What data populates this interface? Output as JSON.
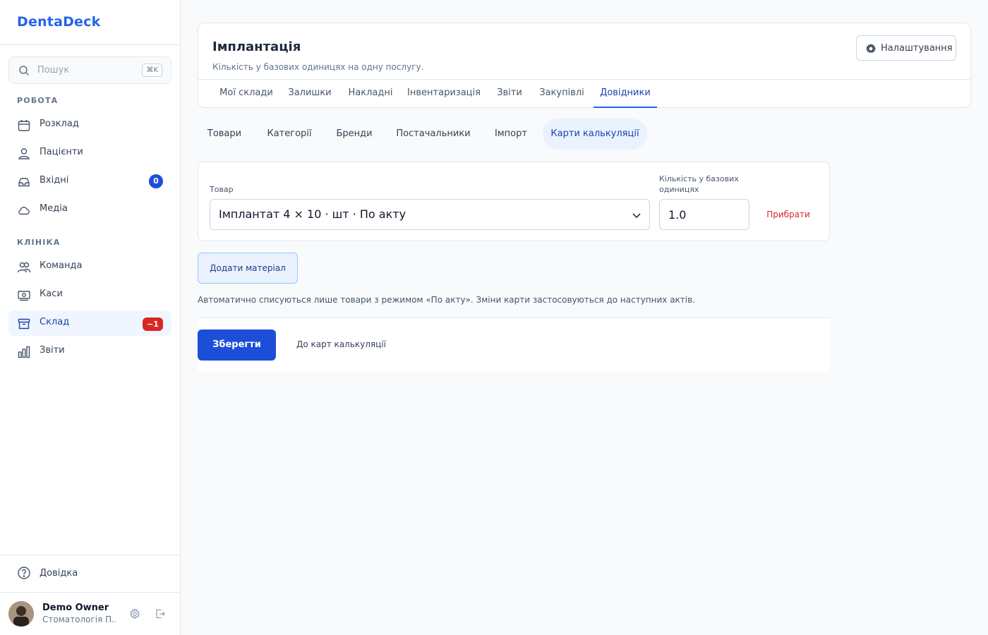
{
  "app": {
    "name": "DentaDeck"
  },
  "search": {
    "placeholder": "Пошук",
    "shortcut": "⌘K"
  },
  "sidebar": {
    "sections": [
      {
        "title": "РОБОТА"
      },
      {
        "title": "КЛІНІКА"
      }
    ],
    "work_items": [
      {
        "label": "Розклад",
        "icon": "calendar-icon"
      },
      {
        "label": "Пацієнти",
        "icon": "patients-icon"
      },
      {
        "label": "Вхідні",
        "icon": "inbox-icon",
        "badge": "0"
      },
      {
        "label": "Медіа",
        "icon": "cloud-icon"
      }
    ],
    "clinic_items": [
      {
        "label": "Команда",
        "icon": "team-icon"
      },
      {
        "label": "Каси",
        "icon": "cash-icon"
      },
      {
        "label": "Склад",
        "icon": "warehouse-icon",
        "badge": "−1",
        "active": true
      },
      {
        "label": "Звіти",
        "icon": "reports-icon"
      }
    ],
    "help": "Довідка",
    "user": {
      "name": "Demo Owner",
      "subtitle": "Стоматологія П..."
    }
  },
  "header": {
    "title": "Імплантація",
    "subtitle": "Кількість у базових одиницях на одну послугу.",
    "settings_label": "Налаштування",
    "tabs": [
      {
        "label": "Мої склади"
      },
      {
        "label": "Залишки"
      },
      {
        "label": "Накладні"
      },
      {
        "label": "Інвентаризація"
      },
      {
        "label": "Звіти"
      },
      {
        "label": "Закупівлі"
      },
      {
        "label": "Довідники",
        "active": true
      }
    ]
  },
  "subtabs": [
    {
      "label": "Товари"
    },
    {
      "label": "Категорії"
    },
    {
      "label": "Бренди"
    },
    {
      "label": "Постачальники"
    },
    {
      "label": "Імпорт"
    },
    {
      "label": "Карти калькуляції",
      "active": true
    }
  ],
  "form": {
    "product_label": "Товар",
    "product_value": "Імплантат 4 × 10 · шт · По акту",
    "qty_label": "Кількість у базових одиницях",
    "qty_value": "1.0",
    "remove_label": "Прибрати",
    "add_label": "Додати матеріал",
    "note": "Автоматично списуються лише товари з режимом «По акту». Зміни карти застосовуються до наступних актів.",
    "save_label": "Зберегти",
    "back_label": "До карт калькуляції"
  },
  "colors": {
    "accent": "#2563eb",
    "primary_button": "#1d4ed8",
    "danger": "#dc2626",
    "active_bg": "#eff6ff"
  }
}
